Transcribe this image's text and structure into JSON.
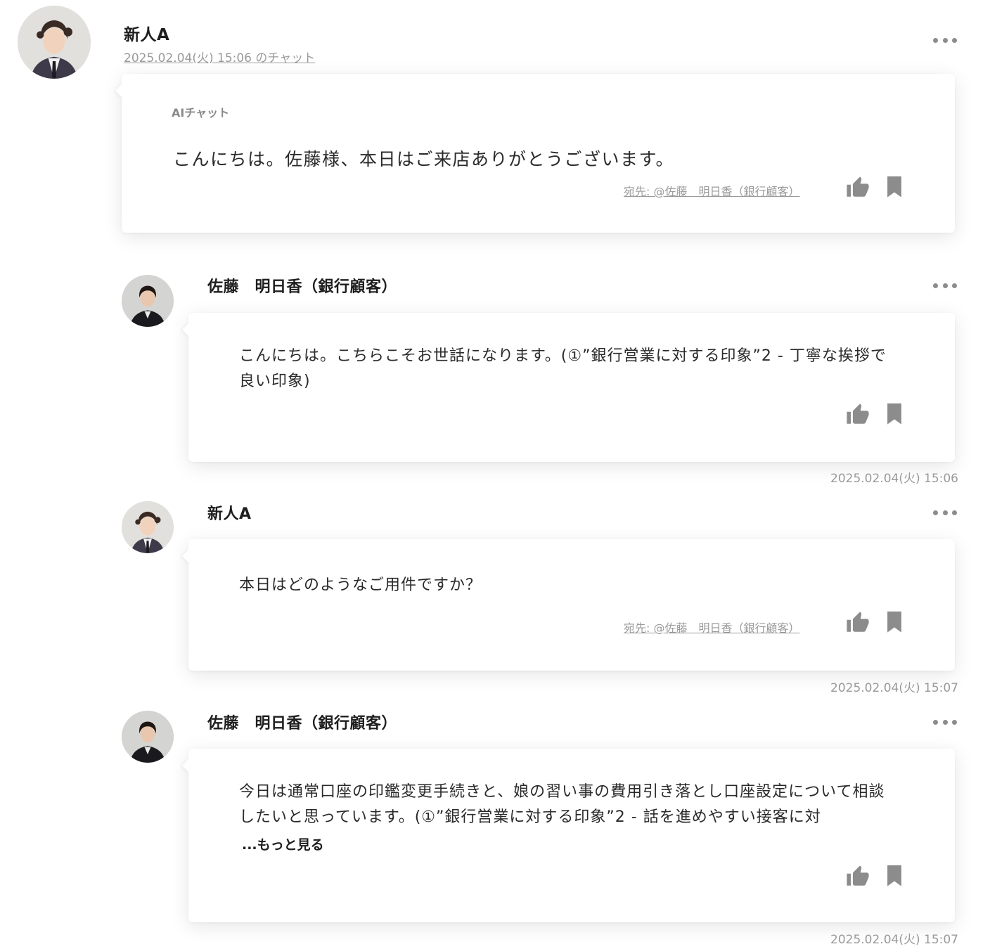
{
  "thread": {
    "author": "新人A",
    "date_link": "2025.02.04(火) 15:06 のチャット"
  },
  "first_card": {
    "label": "AIチャット",
    "text": "こんにちは。佐藤様、本日はご来店ありがとうございます。",
    "recipient": "宛先: @佐藤　明日香（銀行顧客）"
  },
  "messages": [
    {
      "author": "佐藤　明日香（銀行顧客）",
      "line1": "こんにちは。こちらこそお世話になります。(①”銀行営業に対する印象”2 - 丁寧な挨拶で",
      "line2": "良い印象)",
      "timestamp": "2025.02.04(火) 15:06"
    },
    {
      "author": "新人A",
      "line1": "本日はどのようなご用件ですか？",
      "recipient": "宛先: @佐藤　明日香（銀行顧客）",
      "timestamp": "2025.02.04(火) 15:07"
    },
    {
      "author": "佐藤　明日香（銀行顧客）",
      "line1": "今日は通常口座の印鑑変更手続きと、娘の習い事の費用引き落とし口座設定について相談",
      "line2": "したいと思っています。(①”銀行営業に対する印象”2 - 話を進めやすい接客に対",
      "read_more": "...もっと見る",
      "timestamp": "2025.02.04(火) 15:07"
    }
  ],
  "icons": {
    "like": "thumbs-up-icon",
    "bookmark": "bookmark-icon",
    "menu": "more-horizontal-icon"
  },
  "colors": {
    "icon_gray": "#8c8c8c",
    "muted_text": "#9a9a9a"
  }
}
